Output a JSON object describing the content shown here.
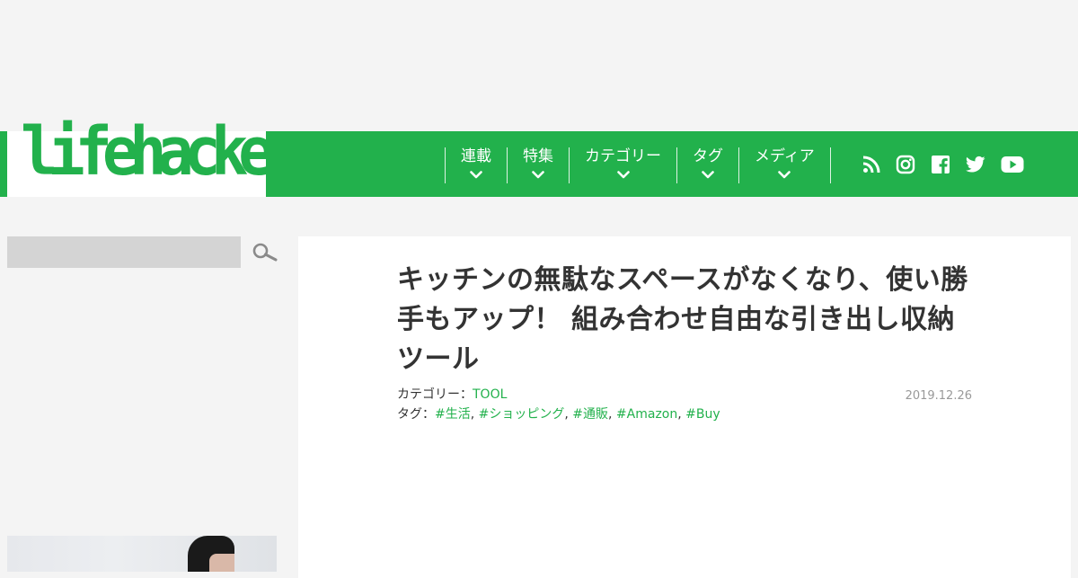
{
  "colors": {
    "brand_green": "#22b14c",
    "background": "#f4f4f4",
    "text": "#333333",
    "muted": "#999999"
  },
  "header": {
    "logo_text": "lifehacker",
    "nav": [
      {
        "label": "連載"
      },
      {
        "label": "特集"
      },
      {
        "label": "カテゴリー"
      },
      {
        "label": "タグ"
      },
      {
        "label": "メディア"
      }
    ],
    "social_icons": [
      "rss-icon",
      "instagram-icon",
      "facebook-icon",
      "twitter-icon",
      "youtube-icon"
    ]
  },
  "sidebar": {
    "search": {
      "value": "",
      "placeholder": ""
    },
    "search_icon": "magnifier-icon"
  },
  "article": {
    "title": "キッチンの無駄なスペースがなくなり、使い勝手もアップ！ 組み合わせ自由な引き出し収納ツール",
    "category_label": "カテゴリー：",
    "category": "TOOL",
    "tags_label": "タグ：",
    "tags": [
      "#生活",
      "#ショッピング",
      "#通販",
      "#Amazon",
      "#Buy"
    ],
    "tag_separator": ", ",
    "date": "2019.12.26"
  }
}
